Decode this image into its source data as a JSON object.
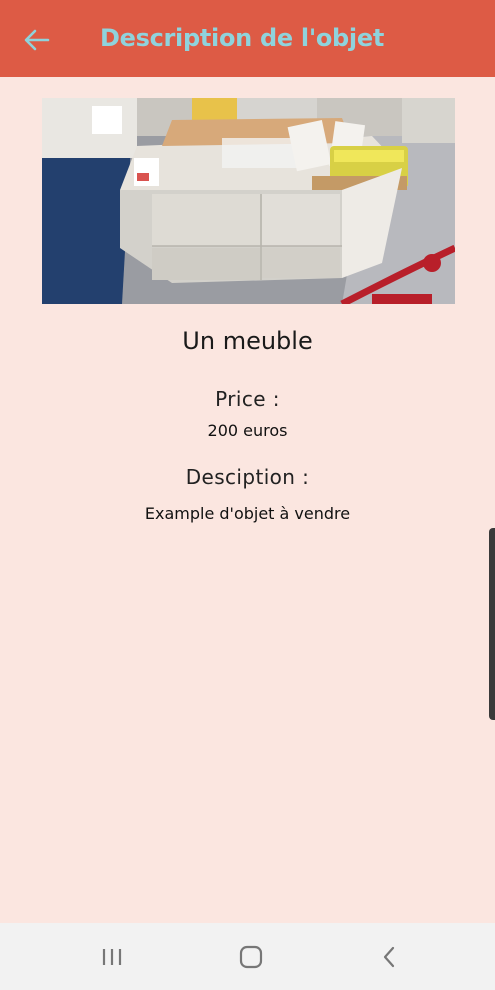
{
  "colors": {
    "app_bar": "#dd5b45",
    "title": "#8fd3dc",
    "background": "#fbe6e0",
    "nav_bar": "#f2f2f2"
  },
  "app_bar": {
    "back_icon": "arrow-left-icon",
    "title": "Description de l'objet"
  },
  "item": {
    "name": "Un meuble",
    "price_label": "Price :",
    "price_value": "200 euros",
    "description_label": "Desciption :",
    "description_value": "Example d'objet à vendre"
  },
  "nav_bar": {
    "recents_icon": "recents-icon",
    "home_icon": "home-icon",
    "back_icon": "back-chevron-icon"
  }
}
